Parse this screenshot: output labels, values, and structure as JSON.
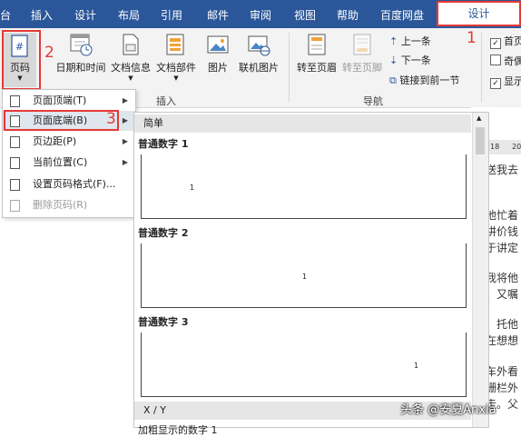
{
  "tabs": [
    "台",
    "插入",
    "设计",
    "布局",
    "引用",
    "邮件",
    "审阅",
    "视图",
    "帮助",
    "百度网盘"
  ],
  "active_tab": "设计",
  "ribbon": {
    "page_number": "页码",
    "datetime": "日期和时间",
    "doc_info": "文档信息",
    "doc_parts": "文档部件",
    "picture": "图片",
    "online_picture": "联机图片",
    "insert_group": "插入",
    "goto_header": "转至页眉",
    "goto_footer": "转至页脚",
    "prev": "上一条",
    "next": "下一条",
    "link_prev": "链接到前一节",
    "nav_group": "导航",
    "checks": [
      "首页",
      "奇偶",
      "显示"
    ]
  },
  "menu": {
    "items": [
      {
        "label": "页面顶端(T)",
        "submenu": true,
        "disabled": false
      },
      {
        "label": "页面底端(B)",
        "submenu": true,
        "disabled": false
      },
      {
        "label": "页边距(P)",
        "submenu": true,
        "disabled": false
      },
      {
        "label": "当前位置(C)",
        "submenu": true,
        "disabled": false
      },
      {
        "label": "设置页码格式(F)...",
        "submenu": false,
        "disabled": false
      },
      {
        "label": "删除页码(R)",
        "submenu": false,
        "disabled": true
      }
    ]
  },
  "gallery": {
    "section_simple": "简单",
    "items": [
      "普通数字 1",
      "普通数字 2",
      "普通数字 3"
    ],
    "preview_number": "1",
    "section_xy": "X / Y",
    "cut_text": "加粗显示的数字 1"
  },
  "steps": [
    "1",
    "2",
    "3"
  ],
  "ruler_marks": [
    "18",
    "20"
  ],
  "doc_text": [
    "送我去",
    "他忙着",
    "讲价钱",
    "于讲定",
    "我将他",
    "。又嘱",
    "，托他",
    "在想想",
    "车外看",
    "栅栏外",
    "走。父"
  ],
  "watermark": "头条 @安夏Anxia",
  "colors": {
    "ribbon_blue": "#2b579a",
    "highlight_red": "#e53935"
  }
}
